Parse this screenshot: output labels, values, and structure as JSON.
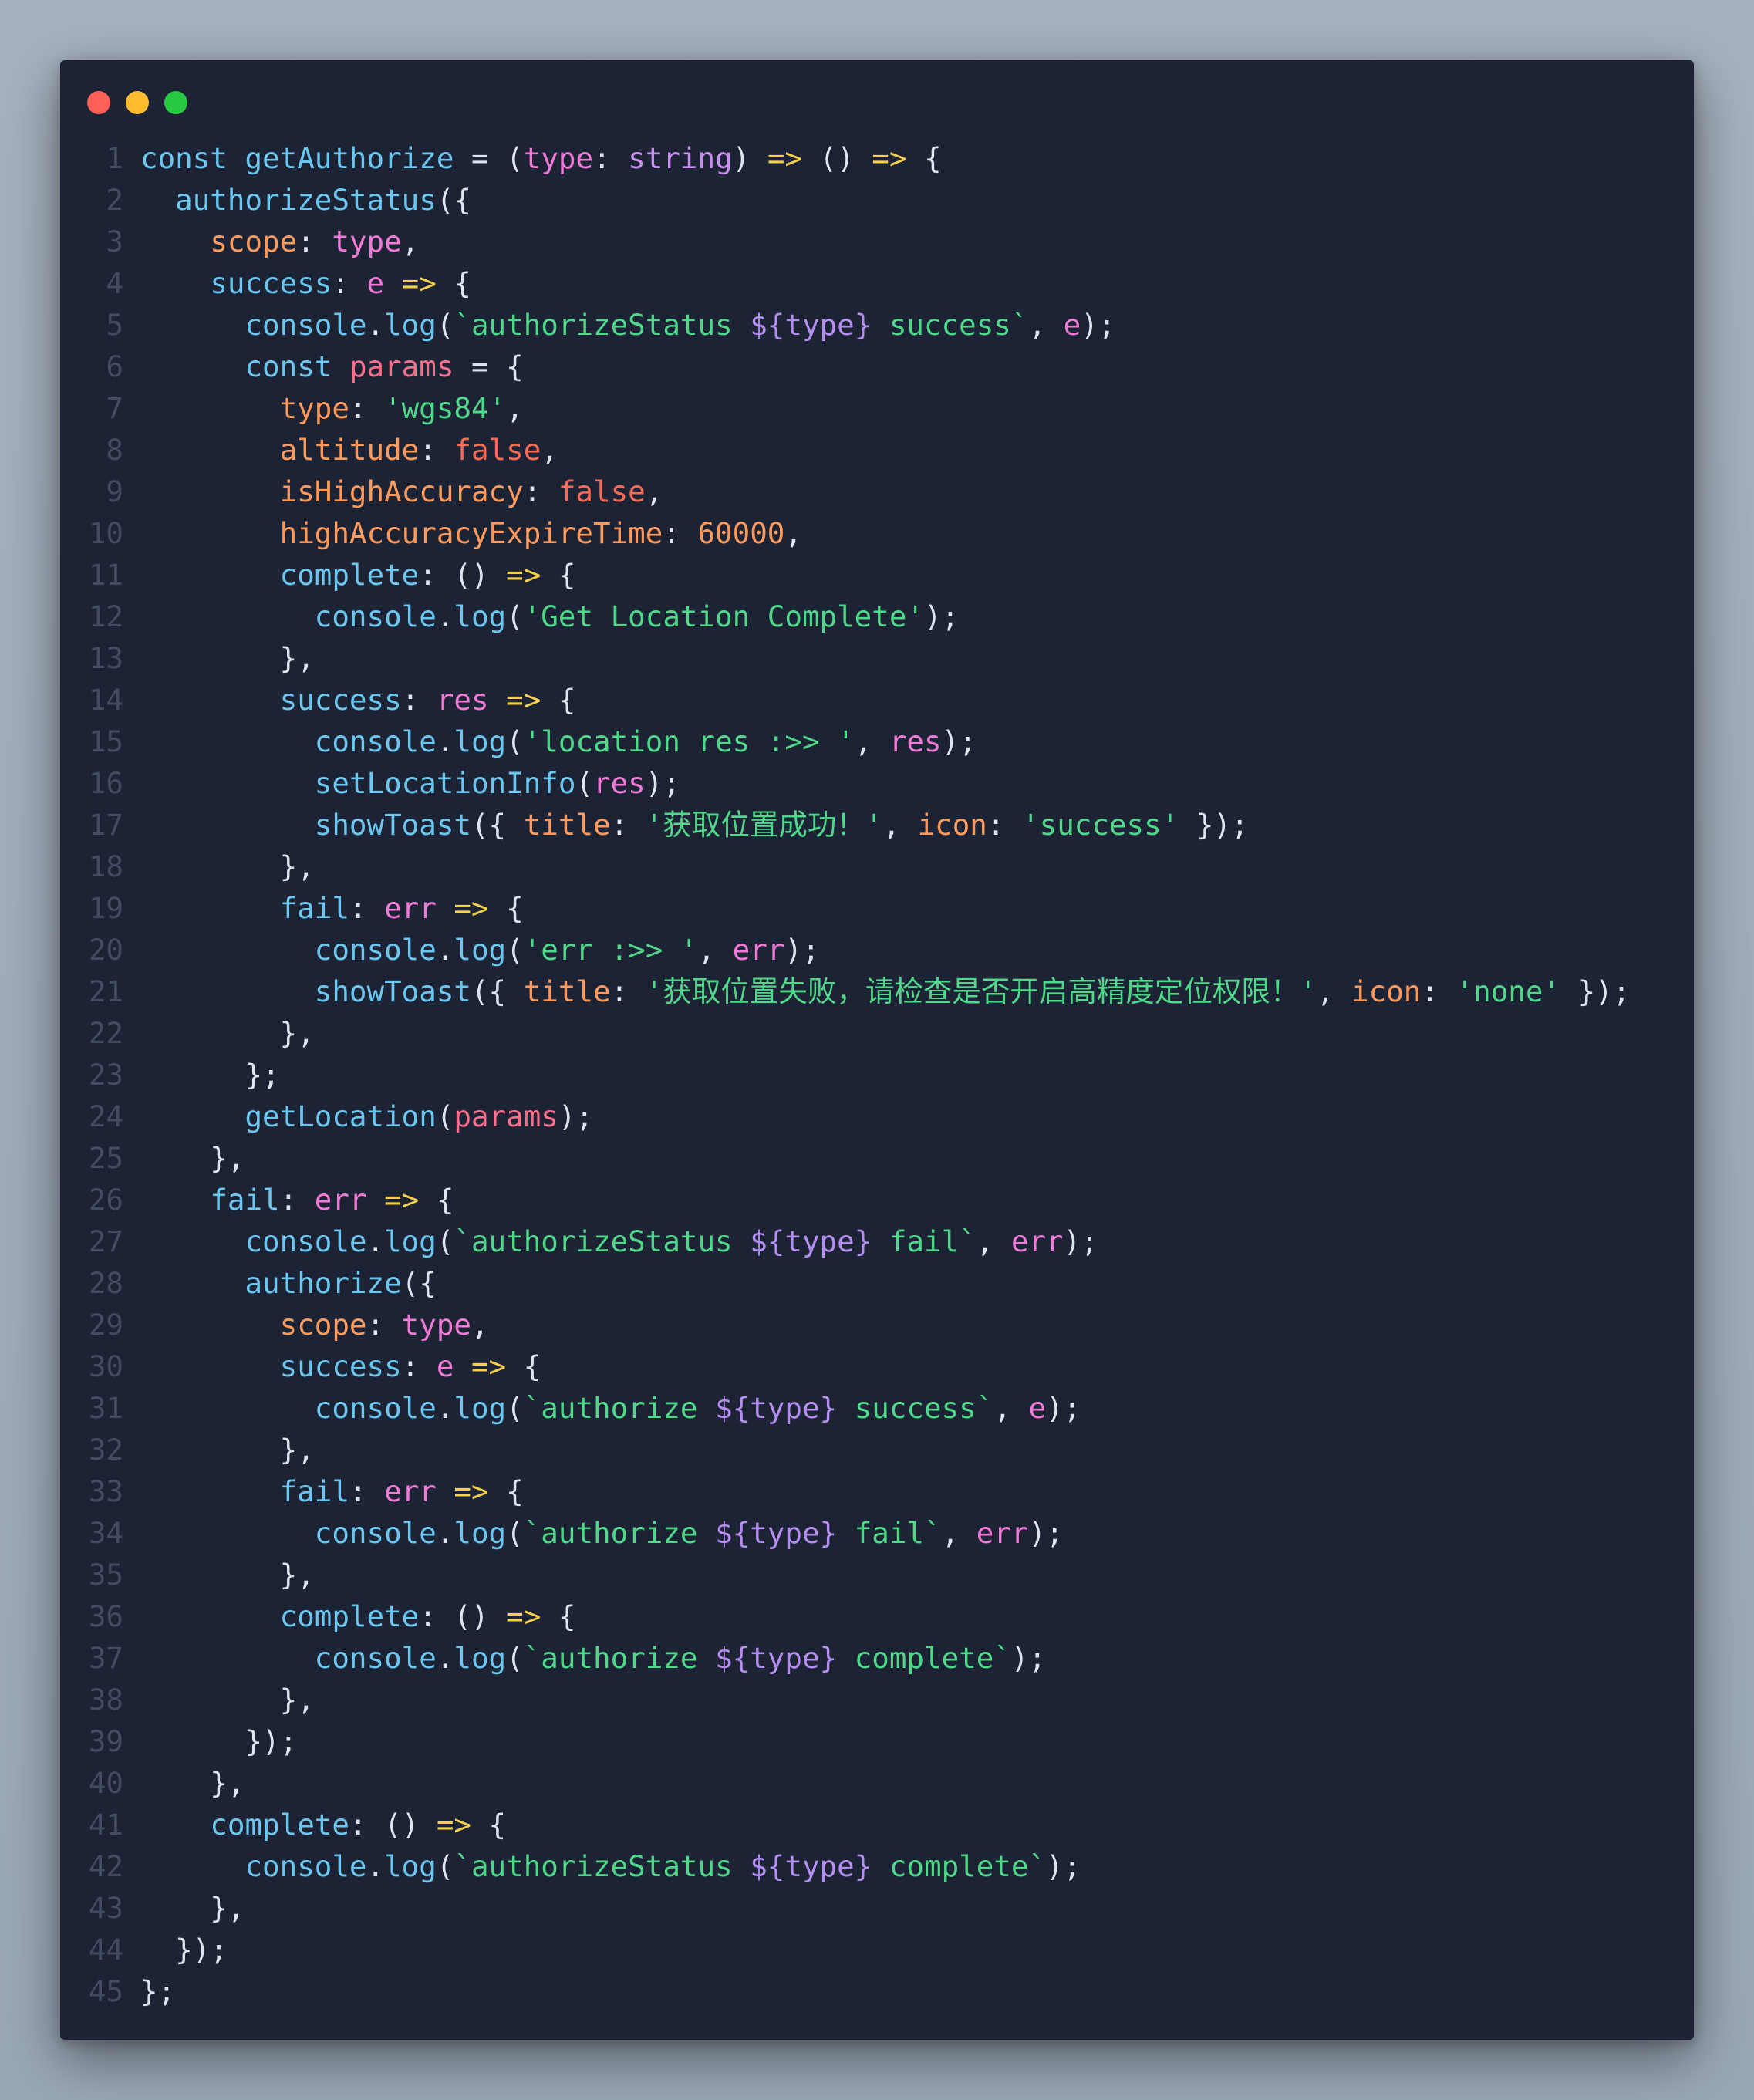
{
  "window": {
    "background": "#1c2334",
    "controls": [
      {
        "name": "close",
        "color": "#ff5f57"
      },
      {
        "name": "minimize",
        "color": "#febc2e"
      },
      {
        "name": "zoom",
        "color": "#28c840"
      }
    ]
  },
  "palette": {
    "p": "#e0e4ee",
    "k": "#6cc7f0",
    "f": "#6cc7f0",
    "v": "#f07ad5",
    "t": "#c98ff0",
    "a": "#f5d04c",
    "o": "#ff9a5c",
    "b": "#ff6a55",
    "n": "#ff9a5c",
    "s": "#4fd889",
    "i": "#b48ef0",
    "c": "#ff6f8c",
    "m": "#f07ad5",
    "g": "#e0e4ee"
  },
  "code": {
    "language": "typescript",
    "lines": [
      {
        "n": "1",
        "t": [
          [
            "k",
            "const "
          ],
          [
            "f",
            "getAuthorize"
          ],
          [
            "p",
            " = ("
          ],
          [
            "v",
            "type"
          ],
          [
            "p",
            ": "
          ],
          [
            "t",
            "string"
          ],
          [
            "p",
            ") "
          ],
          [
            "a",
            "=>"
          ],
          [
            "p",
            " () "
          ],
          [
            "a",
            "=>"
          ],
          [
            "p",
            " {"
          ]
        ]
      },
      {
        "n": "2",
        "t": [
          [
            "p",
            "  "
          ],
          [
            "f",
            "authorizeStatus"
          ],
          [
            "p",
            "({"
          ]
        ]
      },
      {
        "n": "3",
        "t": [
          [
            "p",
            "    "
          ],
          [
            "o",
            "scope"
          ],
          [
            "p",
            ": "
          ],
          [
            "v",
            "type"
          ],
          [
            "p",
            ","
          ]
        ]
      },
      {
        "n": "4",
        "t": [
          [
            "p",
            "    "
          ],
          [
            "f",
            "success"
          ],
          [
            "p",
            ": "
          ],
          [
            "v",
            "e"
          ],
          [
            "p",
            " "
          ],
          [
            "a",
            "=>"
          ],
          [
            "p",
            " {"
          ]
        ]
      },
      {
        "n": "5",
        "t": [
          [
            "p",
            "      "
          ],
          [
            "k",
            "console"
          ],
          [
            "p",
            "."
          ],
          [
            "f",
            "log"
          ],
          [
            "p",
            "("
          ],
          [
            "s",
            "`authorizeStatus "
          ],
          [
            "i",
            "${type}"
          ],
          [
            "s",
            " success`"
          ],
          [
            "p",
            ", "
          ],
          [
            "v",
            "e"
          ],
          [
            "p",
            ");"
          ]
        ]
      },
      {
        "n": "6",
        "t": [
          [
            "p",
            "      "
          ],
          [
            "k",
            "const "
          ],
          [
            "c",
            "params"
          ],
          [
            "p",
            " = {"
          ]
        ]
      },
      {
        "n": "7",
        "t": [
          [
            "p",
            "        "
          ],
          [
            "o",
            "type"
          ],
          [
            "p",
            ": "
          ],
          [
            "s",
            "'wgs84'"
          ],
          [
            "p",
            ","
          ]
        ]
      },
      {
        "n": "8",
        "t": [
          [
            "p",
            "        "
          ],
          [
            "o",
            "altitude"
          ],
          [
            "p",
            ": "
          ],
          [
            "b",
            "false"
          ],
          [
            "p",
            ","
          ]
        ]
      },
      {
        "n": "9",
        "t": [
          [
            "p",
            "        "
          ],
          [
            "o",
            "isHighAccuracy"
          ],
          [
            "p",
            ": "
          ],
          [
            "b",
            "false"
          ],
          [
            "p",
            ","
          ]
        ]
      },
      {
        "n": "10",
        "t": [
          [
            "p",
            "        "
          ],
          [
            "o",
            "highAccuracyExpireTime"
          ],
          [
            "p",
            ": "
          ],
          [
            "n",
            "60000"
          ],
          [
            "p",
            ","
          ]
        ]
      },
      {
        "n": "11",
        "t": [
          [
            "p",
            "        "
          ],
          [
            "f",
            "complete"
          ],
          [
            "p",
            ": () "
          ],
          [
            "a",
            "=>"
          ],
          [
            "p",
            " {"
          ]
        ]
      },
      {
        "n": "12",
        "t": [
          [
            "p",
            "          "
          ],
          [
            "k",
            "console"
          ],
          [
            "p",
            "."
          ],
          [
            "f",
            "log"
          ],
          [
            "p",
            "("
          ],
          [
            "s",
            "'Get Location Complete'"
          ],
          [
            "p",
            ");"
          ]
        ]
      },
      {
        "n": "13",
        "t": [
          [
            "p",
            "        },"
          ]
        ]
      },
      {
        "n": "14",
        "t": [
          [
            "p",
            "        "
          ],
          [
            "f",
            "success"
          ],
          [
            "p",
            ": "
          ],
          [
            "v",
            "res"
          ],
          [
            "p",
            " "
          ],
          [
            "a",
            "=>"
          ],
          [
            "p",
            " {"
          ]
        ]
      },
      {
        "n": "15",
        "t": [
          [
            "p",
            "          "
          ],
          [
            "k",
            "console"
          ],
          [
            "p",
            "."
          ],
          [
            "f",
            "log"
          ],
          [
            "p",
            "("
          ],
          [
            "s",
            "'location res :>> '"
          ],
          [
            "p",
            ", "
          ],
          [
            "v",
            "res"
          ],
          [
            "p",
            ");"
          ]
        ]
      },
      {
        "n": "16",
        "t": [
          [
            "p",
            "          "
          ],
          [
            "f",
            "setLocationInfo"
          ],
          [
            "p",
            "("
          ],
          [
            "v",
            "res"
          ],
          [
            "p",
            ");"
          ]
        ]
      },
      {
        "n": "17",
        "t": [
          [
            "p",
            "          "
          ],
          [
            "f",
            "showToast"
          ],
          [
            "p",
            "({ "
          ],
          [
            "o",
            "title"
          ],
          [
            "p",
            ": "
          ],
          [
            "s",
            "'获取位置成功！'"
          ],
          [
            "p",
            ", "
          ],
          [
            "o",
            "icon"
          ],
          [
            "p",
            ": "
          ],
          [
            "s",
            "'success'"
          ],
          [
            "p",
            " });"
          ]
        ]
      },
      {
        "n": "18",
        "t": [
          [
            "p",
            "        },"
          ]
        ]
      },
      {
        "n": "19",
        "t": [
          [
            "p",
            "        "
          ],
          [
            "f",
            "fail"
          ],
          [
            "p",
            ": "
          ],
          [
            "v",
            "err"
          ],
          [
            "p",
            " "
          ],
          [
            "a",
            "=>"
          ],
          [
            "p",
            " {"
          ]
        ]
      },
      {
        "n": "20",
        "t": [
          [
            "p",
            "          "
          ],
          [
            "k",
            "console"
          ],
          [
            "p",
            "."
          ],
          [
            "f",
            "log"
          ],
          [
            "p",
            "("
          ],
          [
            "s",
            "'err :>> '"
          ],
          [
            "p",
            ", "
          ],
          [
            "v",
            "err"
          ],
          [
            "p",
            ");"
          ]
        ]
      },
      {
        "n": "21",
        "t": [
          [
            "p",
            "          "
          ],
          [
            "f",
            "showToast"
          ],
          [
            "p",
            "({ "
          ],
          [
            "o",
            "title"
          ],
          [
            "p",
            ": "
          ],
          [
            "s",
            "'获取位置失败，请检查是否开启高精度定位权限！'"
          ],
          [
            "p",
            ", "
          ],
          [
            "o",
            "icon"
          ],
          [
            "p",
            ": "
          ],
          [
            "s",
            "'none'"
          ],
          [
            "p",
            " });"
          ]
        ]
      },
      {
        "n": "22",
        "t": [
          [
            "p",
            "        },"
          ]
        ]
      },
      {
        "n": "23",
        "t": [
          [
            "p",
            "      };"
          ]
        ]
      },
      {
        "n": "24",
        "t": [
          [
            "p",
            "      "
          ],
          [
            "f",
            "getLocation"
          ],
          [
            "p",
            "("
          ],
          [
            "c",
            "params"
          ],
          [
            "p",
            ");"
          ]
        ]
      },
      {
        "n": "25",
        "t": [
          [
            "p",
            "    },"
          ]
        ]
      },
      {
        "n": "26",
        "t": [
          [
            "p",
            "    "
          ],
          [
            "f",
            "fail"
          ],
          [
            "p",
            ": "
          ],
          [
            "v",
            "err"
          ],
          [
            "p",
            " "
          ],
          [
            "a",
            "=>"
          ],
          [
            "p",
            " {"
          ]
        ]
      },
      {
        "n": "27",
        "t": [
          [
            "p",
            "      "
          ],
          [
            "k",
            "console"
          ],
          [
            "p",
            "."
          ],
          [
            "f",
            "log"
          ],
          [
            "p",
            "("
          ],
          [
            "s",
            "`authorizeStatus "
          ],
          [
            "i",
            "${type}"
          ],
          [
            "s",
            " fail`"
          ],
          [
            "p",
            ", "
          ],
          [
            "v",
            "err"
          ],
          [
            "p",
            ");"
          ]
        ]
      },
      {
        "n": "28",
        "t": [
          [
            "p",
            "      "
          ],
          [
            "f",
            "authorize"
          ],
          [
            "p",
            "({"
          ]
        ]
      },
      {
        "n": "29",
        "t": [
          [
            "p",
            "        "
          ],
          [
            "o",
            "scope"
          ],
          [
            "p",
            ": "
          ],
          [
            "v",
            "type"
          ],
          [
            "p",
            ","
          ]
        ]
      },
      {
        "n": "30",
        "t": [
          [
            "p",
            "        "
          ],
          [
            "f",
            "success"
          ],
          [
            "p",
            ": "
          ],
          [
            "v",
            "e"
          ],
          [
            "p",
            " "
          ],
          [
            "a",
            "=>"
          ],
          [
            "p",
            " {"
          ]
        ]
      },
      {
        "n": "31",
        "t": [
          [
            "p",
            "          "
          ],
          [
            "k",
            "console"
          ],
          [
            "p",
            "."
          ],
          [
            "f",
            "log"
          ],
          [
            "p",
            "("
          ],
          [
            "s",
            "`authorize "
          ],
          [
            "i",
            "${type}"
          ],
          [
            "s",
            " success`"
          ],
          [
            "p",
            ", "
          ],
          [
            "v",
            "e"
          ],
          [
            "p",
            ");"
          ]
        ]
      },
      {
        "n": "32",
        "t": [
          [
            "p",
            "        },"
          ]
        ]
      },
      {
        "n": "33",
        "t": [
          [
            "p",
            "        "
          ],
          [
            "f",
            "fail"
          ],
          [
            "p",
            ": "
          ],
          [
            "v",
            "err"
          ],
          [
            "p",
            " "
          ],
          [
            "a",
            "=>"
          ],
          [
            "p",
            " {"
          ]
        ]
      },
      {
        "n": "34",
        "t": [
          [
            "p",
            "          "
          ],
          [
            "k",
            "console"
          ],
          [
            "p",
            "."
          ],
          [
            "f",
            "log"
          ],
          [
            "p",
            "("
          ],
          [
            "s",
            "`authorize "
          ],
          [
            "i",
            "${type}"
          ],
          [
            "s",
            " fail`"
          ],
          [
            "p",
            ", "
          ],
          [
            "v",
            "err"
          ],
          [
            "p",
            ");"
          ]
        ]
      },
      {
        "n": "35",
        "t": [
          [
            "p",
            "        },"
          ]
        ]
      },
      {
        "n": "36",
        "t": [
          [
            "p",
            "        "
          ],
          [
            "f",
            "complete"
          ],
          [
            "p",
            ": () "
          ],
          [
            "a",
            "=>"
          ],
          [
            "p",
            " {"
          ]
        ]
      },
      {
        "n": "37",
        "t": [
          [
            "p",
            "          "
          ],
          [
            "k",
            "console"
          ],
          [
            "p",
            "."
          ],
          [
            "f",
            "log"
          ],
          [
            "p",
            "("
          ],
          [
            "s",
            "`authorize "
          ],
          [
            "i",
            "${type}"
          ],
          [
            "s",
            " complete`"
          ],
          [
            "p",
            ");"
          ]
        ]
      },
      {
        "n": "38",
        "t": [
          [
            "p",
            "        },"
          ]
        ]
      },
      {
        "n": "39",
        "t": [
          [
            "p",
            "      });"
          ]
        ]
      },
      {
        "n": "40",
        "t": [
          [
            "p",
            "    },"
          ]
        ]
      },
      {
        "n": "41",
        "t": [
          [
            "p",
            "    "
          ],
          [
            "f",
            "complete"
          ],
          [
            "p",
            ": () "
          ],
          [
            "a",
            "=>"
          ],
          [
            "p",
            " {"
          ]
        ]
      },
      {
        "n": "42",
        "t": [
          [
            "p",
            "      "
          ],
          [
            "k",
            "console"
          ],
          [
            "p",
            "."
          ],
          [
            "f",
            "log"
          ],
          [
            "p",
            "("
          ],
          [
            "s",
            "`authorizeStatus "
          ],
          [
            "i",
            "${type}"
          ],
          [
            "s",
            " complete`"
          ],
          [
            "p",
            ");"
          ]
        ]
      },
      {
        "n": "43",
        "t": [
          [
            "p",
            "    },"
          ]
        ]
      },
      {
        "n": "44",
        "t": [
          [
            "p",
            "  });"
          ]
        ]
      },
      {
        "n": "45",
        "t": [
          [
            "p",
            "};"
          ]
        ]
      }
    ]
  }
}
